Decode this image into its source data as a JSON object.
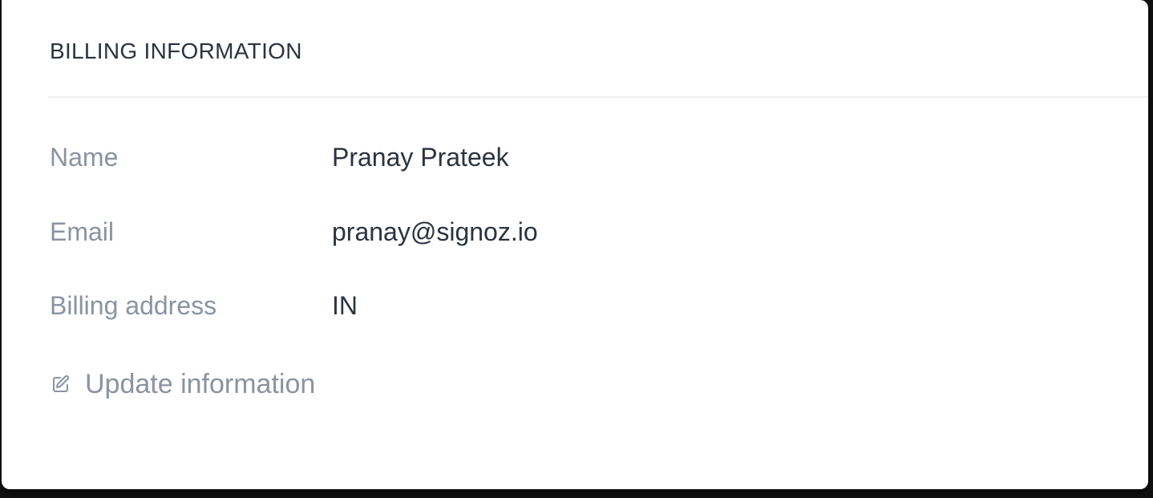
{
  "billing": {
    "title": "BILLING INFORMATION",
    "fields": {
      "name": {
        "label": "Name",
        "value": "Pranay Prateek"
      },
      "email": {
        "label": "Email",
        "value": "pranay@signoz.io"
      },
      "address": {
        "label": "Billing address",
        "value": "IN"
      }
    },
    "update_action": {
      "icon": "edit-icon",
      "label": "Update information"
    }
  },
  "colors": {
    "card_background": "#ffffff",
    "label_text": "#8a93a1",
    "value_text": "#2c3340",
    "divider": "#eceef1"
  }
}
